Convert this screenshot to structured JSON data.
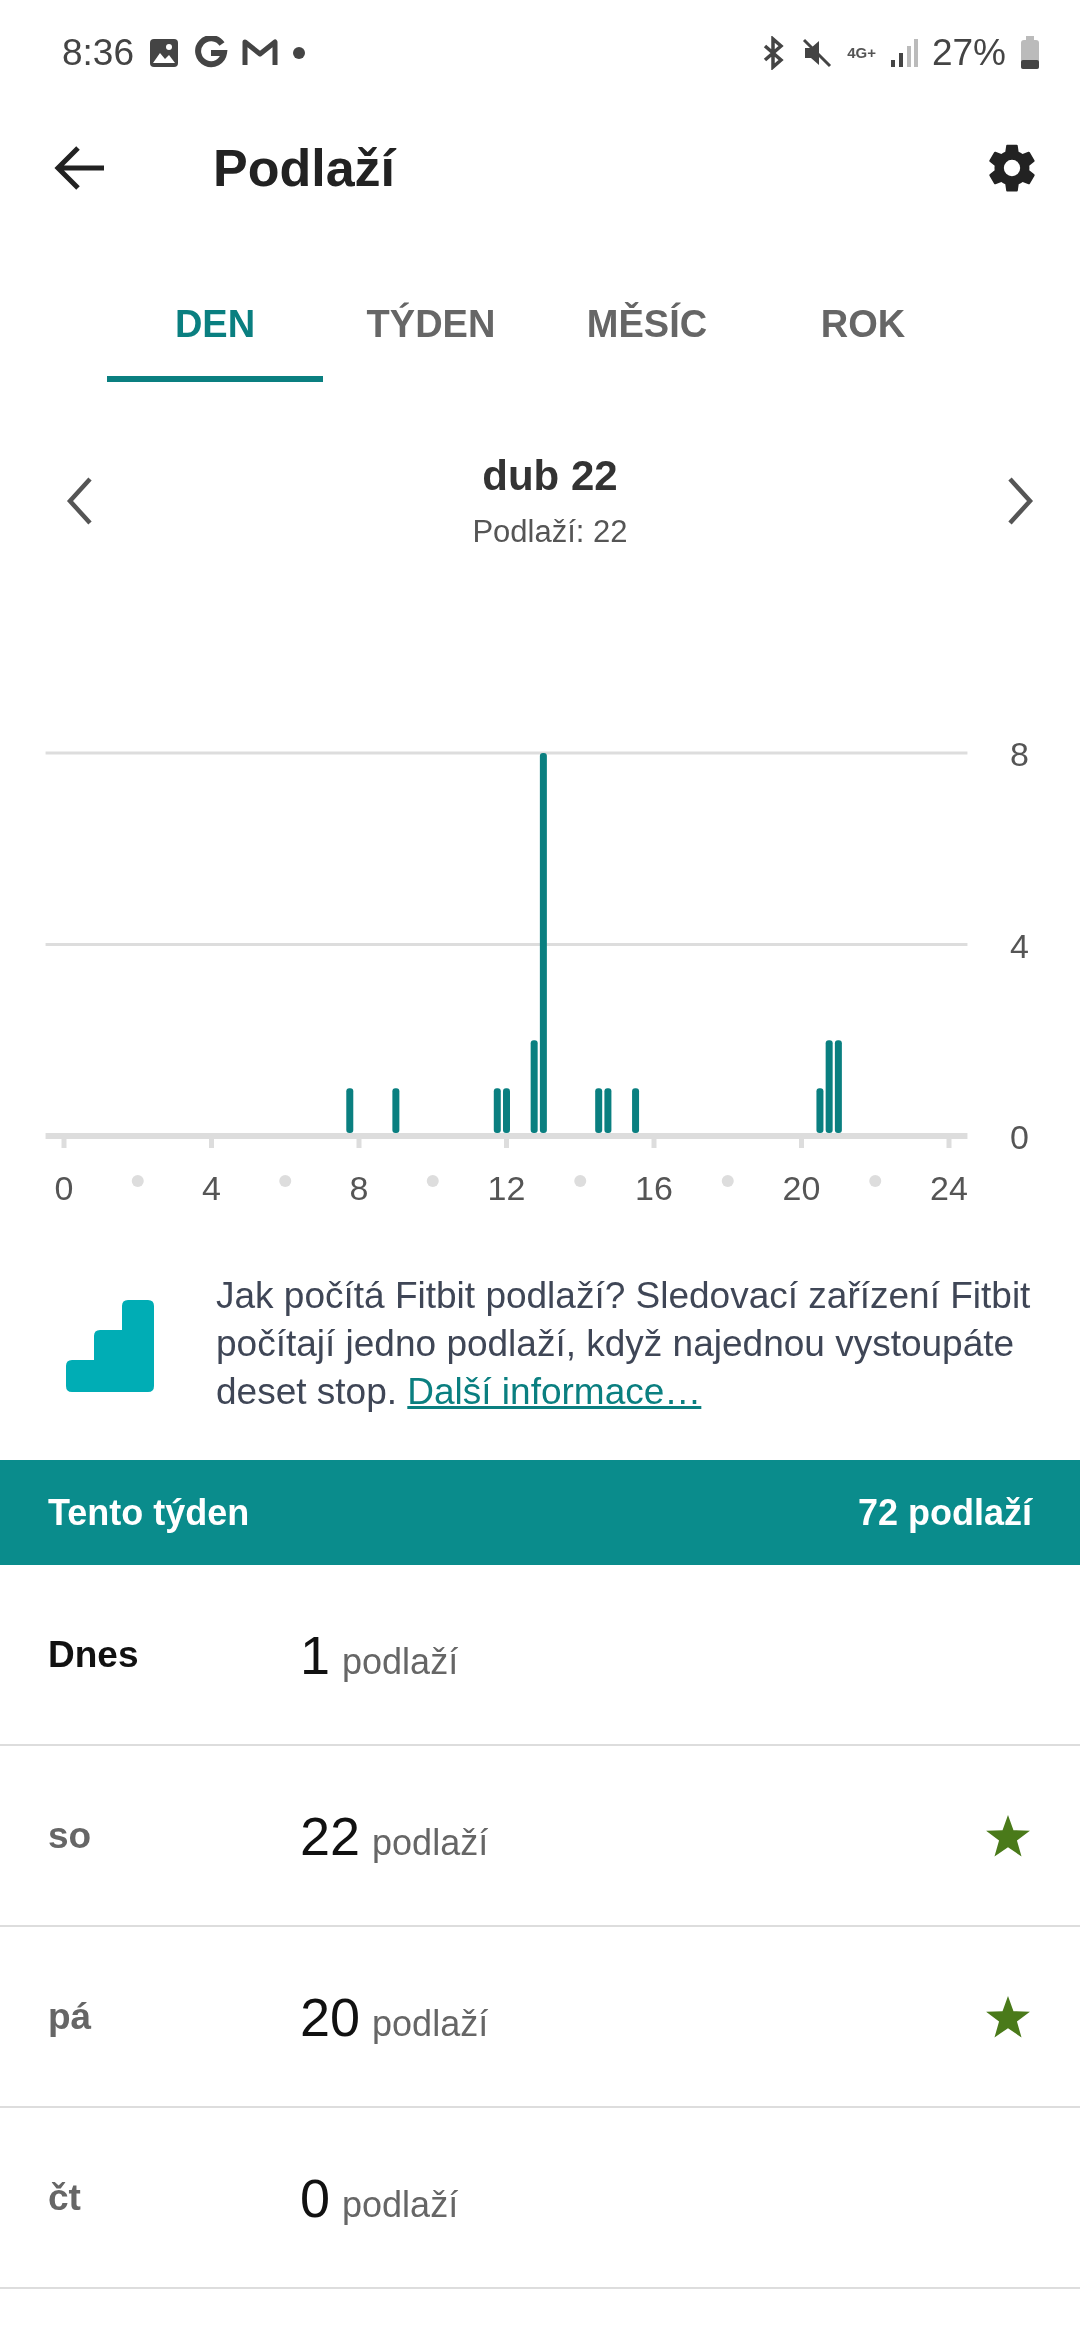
{
  "status_bar": {
    "time": "8:36",
    "battery": "27%",
    "network": "4G+"
  },
  "app_bar": {
    "title": "Podlaží"
  },
  "tabs": [
    {
      "label": "DEN",
      "selected": true
    },
    {
      "label": "TÝDEN",
      "selected": false
    },
    {
      "label": "MĚSÍC",
      "selected": false
    },
    {
      "label": "ROK",
      "selected": false
    }
  ],
  "date_nav": {
    "date": "dub 22",
    "summary": "Podlaží: 22"
  },
  "chart": {
    "chart_data": {
      "type": "bar",
      "x": [
        7.75,
        9,
        11.75,
        12,
        12.75,
        13,
        14.5,
        14.75,
        15.5,
        20.5,
        20.75,
        21
      ],
      "values": [
        1,
        1,
        1,
        1,
        2,
        8,
        1,
        1,
        1,
        1,
        2,
        2
      ],
      "xlim": [
        -0.5,
        24.5
      ],
      "ylim": [
        0,
        8
      ],
      "xticks": [
        0,
        4,
        8,
        12,
        16,
        20,
        24
      ],
      "yticks": [
        0,
        4,
        8
      ],
      "color": "#0a7f80"
    }
  },
  "info": {
    "text": "Jak počítá Fitbit podlaží? Sledovací zařízení Fitbit počítají jedno podlaží, když najednou vystoupáte deset stop.",
    "link": "Další informace…"
  },
  "week_header": {
    "label": "Tento týden",
    "total": "72 podlaží"
  },
  "days": [
    {
      "day": "Dnes",
      "today": true,
      "value": "1",
      "unit": "podlaží",
      "goal_met": false
    },
    {
      "day": "so",
      "today": false,
      "value": "22",
      "unit": "podlaží",
      "goal_met": true
    },
    {
      "day": "pá",
      "today": false,
      "value": "20",
      "unit": "podlaží",
      "goal_met": true
    },
    {
      "day": "čt",
      "today": false,
      "value": "0",
      "unit": "podlaží",
      "goal_met": false
    }
  ]
}
